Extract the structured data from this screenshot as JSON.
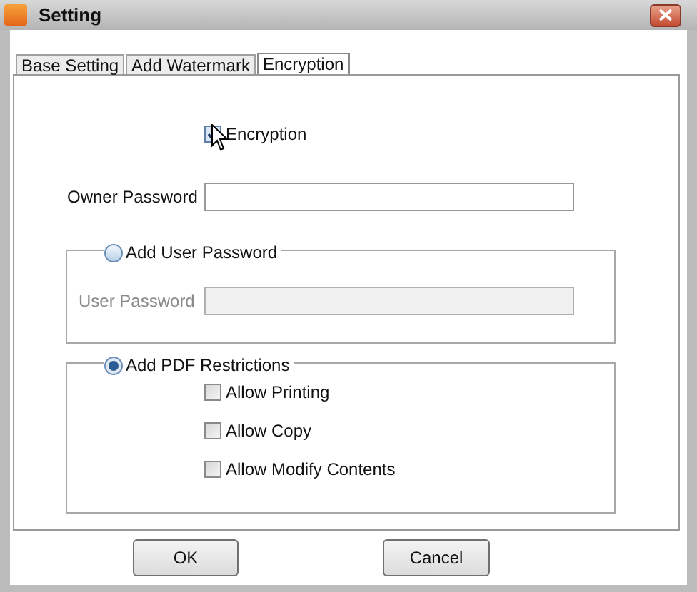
{
  "window": {
    "title": "Setting"
  },
  "tabs": [
    {
      "label": "Base Setting",
      "selected": false
    },
    {
      "label": "Add Watermark",
      "selected": false
    },
    {
      "label": "Encryption",
      "selected": true
    }
  ],
  "encryption": {
    "label": "Encryption",
    "checked": true
  },
  "owner_password": {
    "label": "Owner Password"
  },
  "user_password_group": {
    "label": "Add User Password",
    "selected": false,
    "field_label": "User Password",
    "disabled": true
  },
  "restrictions_group": {
    "label": "Add PDF Restrictions",
    "selected": true,
    "options": [
      {
        "label": "Allow Printing",
        "checked": false
      },
      {
        "label": "Allow Copy",
        "checked": false
      },
      {
        "label": "Allow Modify Contents",
        "checked": false
      }
    ]
  },
  "buttons": [
    "OK",
    "Cancel"
  ]
}
